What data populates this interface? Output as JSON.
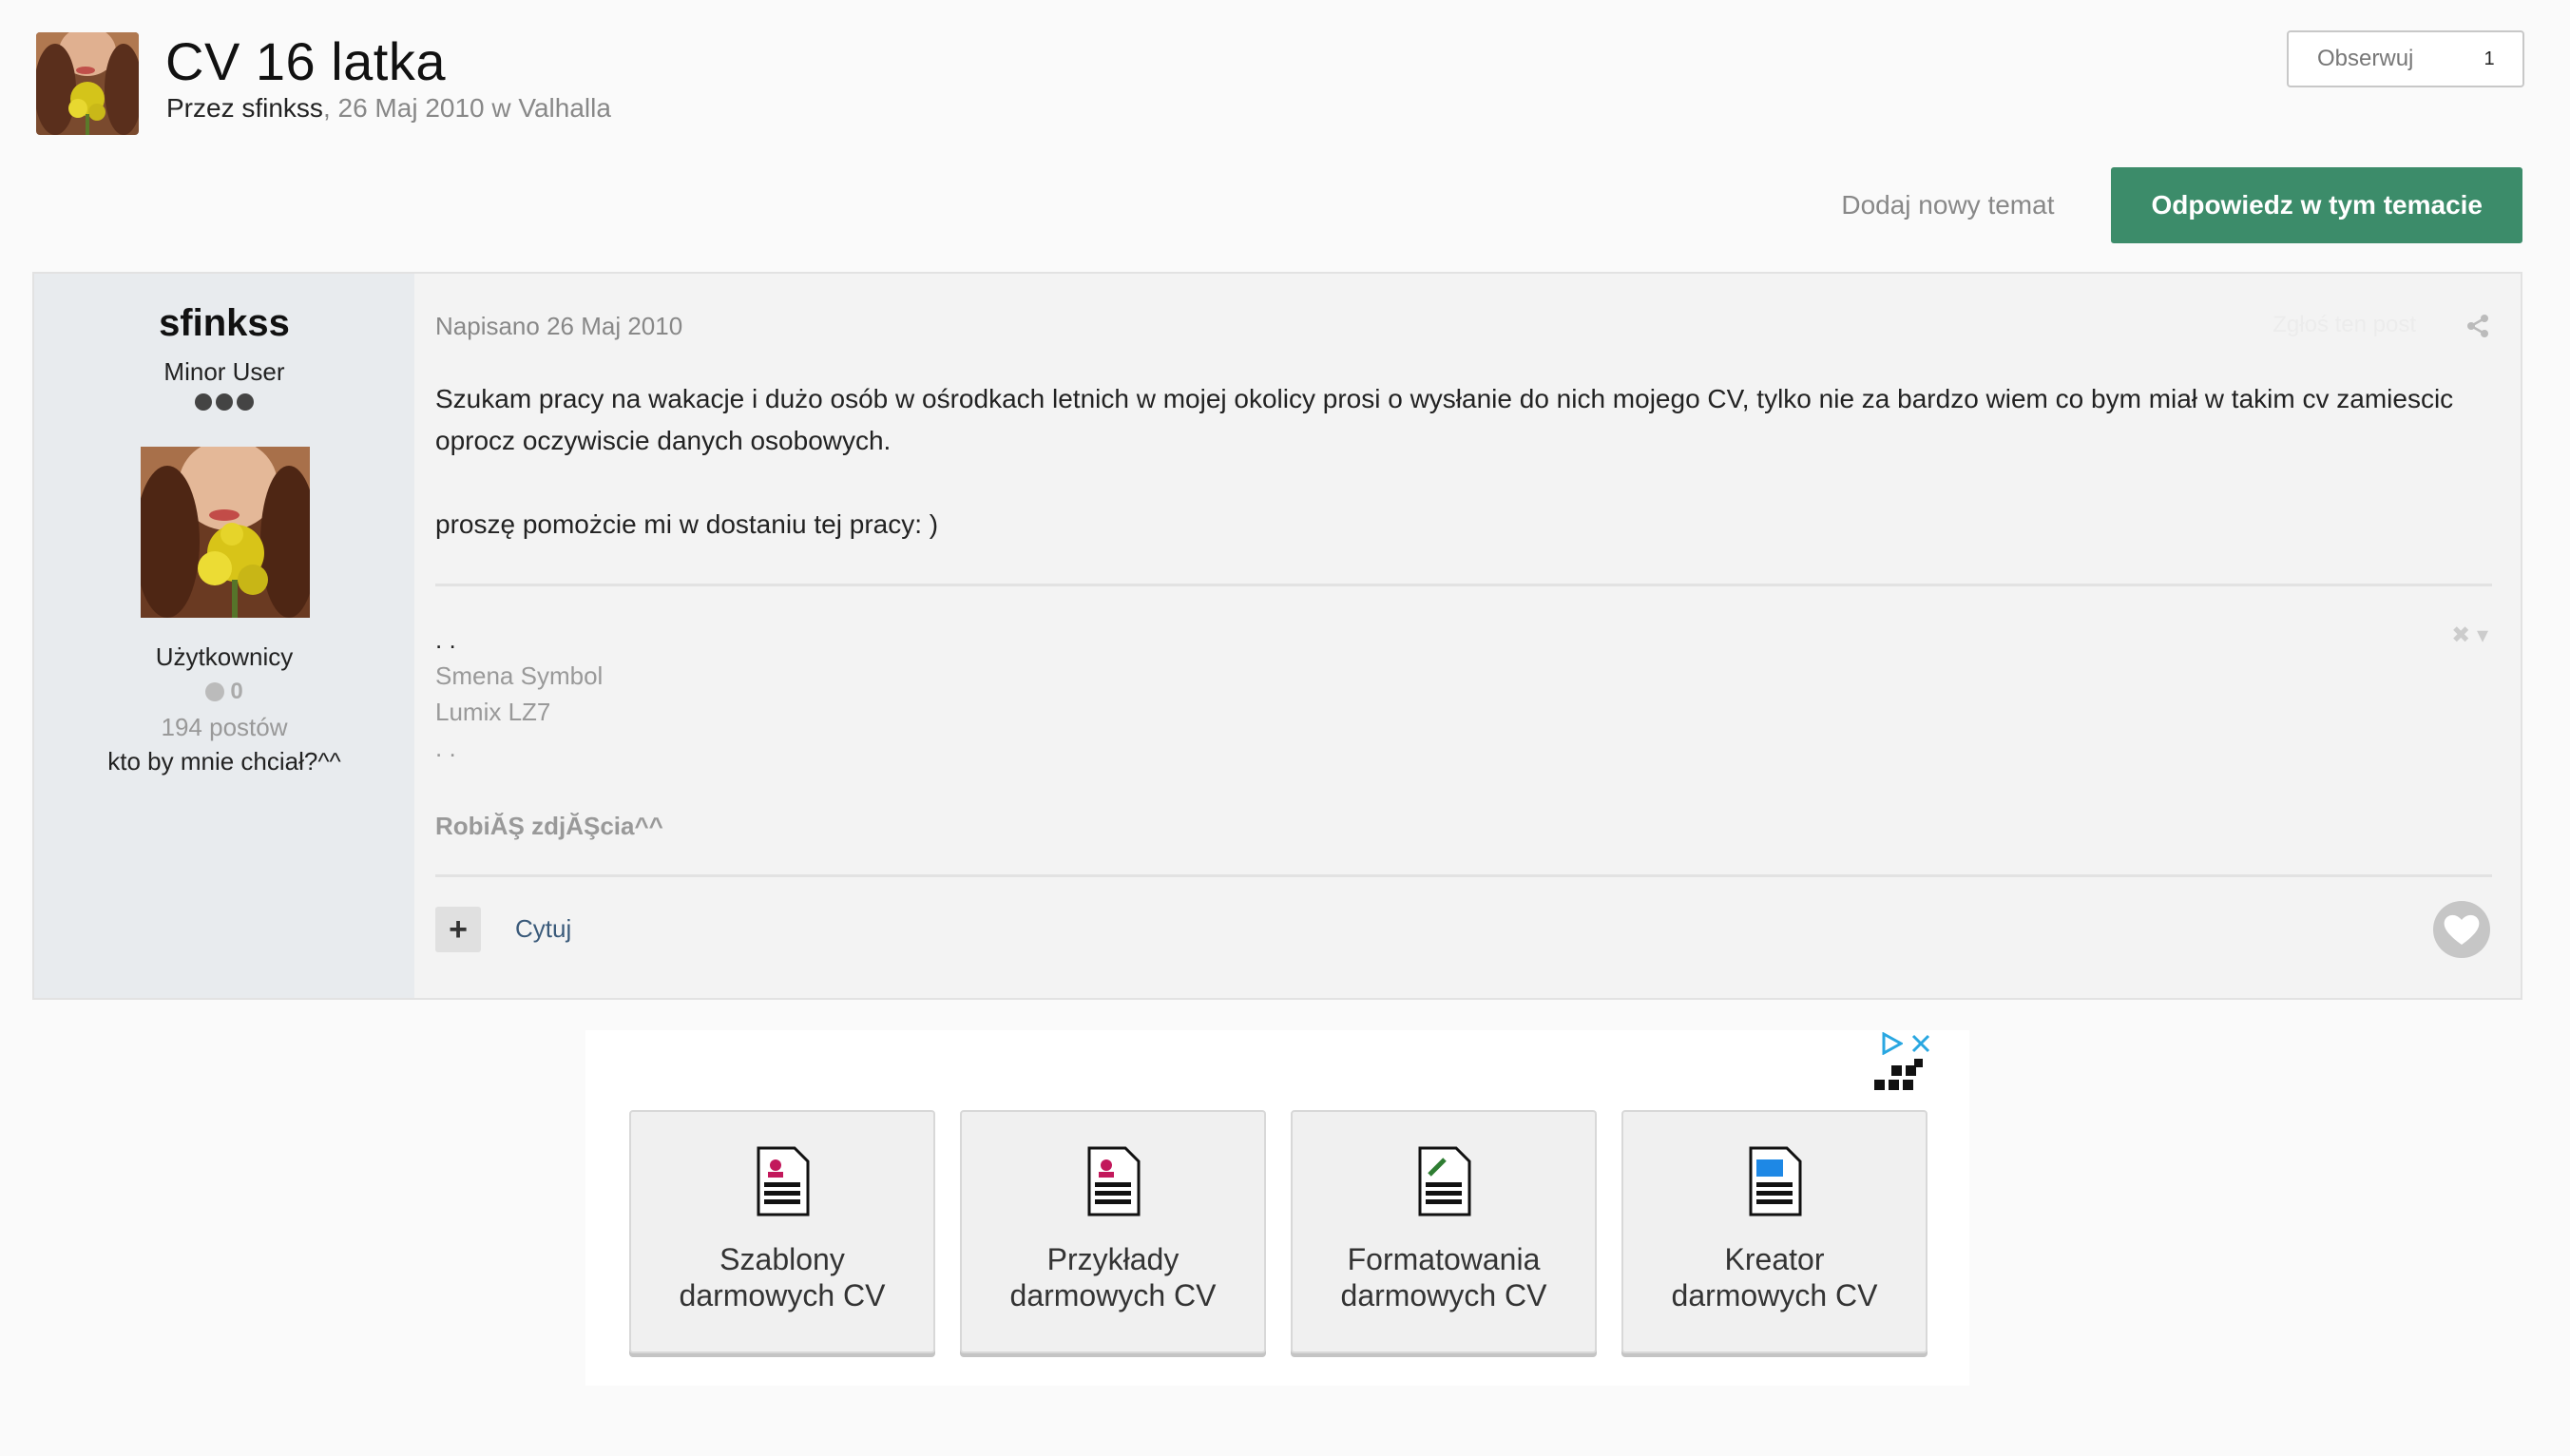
{
  "topic": {
    "title": "CV 16 latka",
    "meta_prefix": "Przez ",
    "author": "sfinkss",
    "meta_suffix": ", 26 Maj 2010 w Valhalla",
    "follow_label": "Obserwuj",
    "follow_count": "1"
  },
  "actions": {
    "new_topic": "Dodaj nowy temat",
    "reply": "Odpowiedz w tym temacie"
  },
  "post": {
    "author": {
      "name": "sfinkss",
      "rank": "Minor User",
      "group": "Użytkownicy",
      "reputation": "0",
      "post_count": "194 postów",
      "custom_title": "kto by mnie chciał?^^"
    },
    "posted": "Napisano 26 Maj 2010",
    "report": "Zgłoś ten post",
    "body": [
      "Szukam pracy na wakacje i dużo osób w ośrodkach letnich w mojej okolicy prosi o wysłanie do nich mojego CV, tylko nie za bardzo wiem co bym miał w takim cv zamiescic oprocz oczywiscie danych osobowych.",
      "proszę pomożcie mi w dostaniu tej pracy: )"
    ],
    "signature": {
      "dots_top": ". .",
      "line1": "Smena Symbol",
      "line2": "Lumix LZ7",
      "dots_bottom": ". .",
      "bold": "RobiĂŞ zdjĂŞcia^^"
    },
    "quote": "Cytuj",
    "plus": "+"
  },
  "ad": {
    "tiles": [
      {
        "line1": "Szablony",
        "line2": "darmowych CV",
        "accent": "#c2185b"
      },
      {
        "line1": "Przykłady",
        "line2": "darmowych CV",
        "accent": "#c2185b"
      },
      {
        "line1": "Formatowania",
        "line2": "darmowych CV",
        "accent": "#2e7d32"
      },
      {
        "line1": "Kreator",
        "line2": "darmowych CV",
        "accent": "#1e88e5"
      }
    ],
    "choices_color": "#29a7e1"
  }
}
